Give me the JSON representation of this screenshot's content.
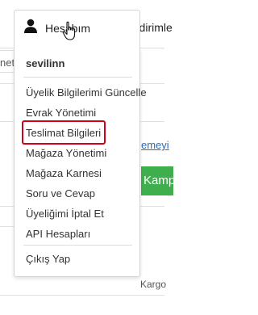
{
  "header": {
    "account_label": "Hesabım",
    "notifications_label": "Bildirimle",
    "icons": [
      "user-icon",
      "cursor-hand-icon",
      "bell-icon"
    ]
  },
  "background": {
    "left_panel_text": "neti",
    "link_text": "emeyi",
    "green_button_label": "Kamp",
    "cargo_text": "Kargo"
  },
  "dropdown": {
    "username": "sevilinn",
    "items": [
      {
        "label": "Üyelik Bilgilerimi Güncelle"
      },
      {
        "label": "Evrak Yönetimi"
      },
      {
        "label": "Teslimat Bilgileri",
        "highlighted": true
      },
      {
        "label": "Mağaza Yönetimi"
      },
      {
        "label": "Mağaza Karnesi"
      },
      {
        "label": "Soru ve Cevap"
      },
      {
        "label": "Üyeliğimi İptal Et"
      },
      {
        "label": "API Hesapları"
      }
    ],
    "logout_label": "Çıkış Yap",
    "highlight_color": "#d0021b"
  },
  "colors": {
    "green_button": "#3fae4c",
    "link": "#2a6ab8"
  }
}
